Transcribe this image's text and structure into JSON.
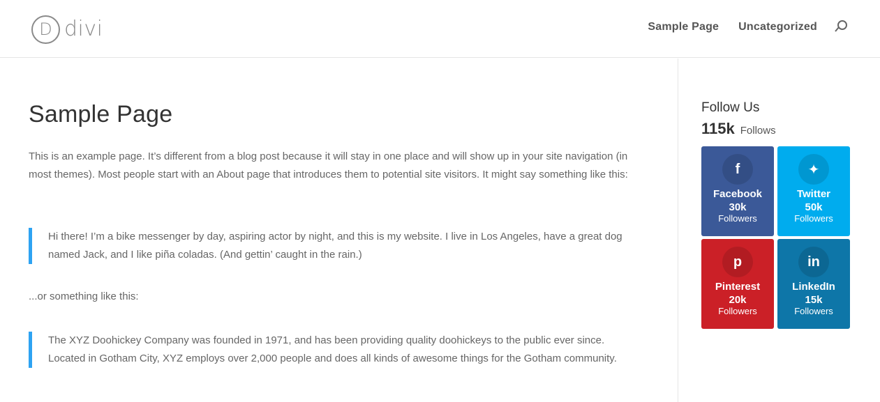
{
  "header": {
    "logo_letter": "D",
    "logo_text": "divi",
    "nav": [
      {
        "label": "Sample Page"
      },
      {
        "label": "Uncategorized"
      }
    ]
  },
  "main": {
    "title": "Sample Page",
    "intro": "This is an example page. It’s different from a blog post because it will stay in one place and will show up in your site navigation (in most themes). Most people start with an About page that introduces them to potential site visitors. It might say something like this:",
    "quote1": "Hi there! I’m a bike messenger by day, aspiring actor by night, and this is my website. I live in Los Angeles, have a great dog named Jack, and I like piña coladas. (And gettin’ caught in the rain.)",
    "between": "...or something like this:",
    "quote2": "The XYZ Doohickey Company was founded in 1971, and has been providing quality doohickeys to the public ever since. Located in Gotham City, XYZ employs over 2,000 people and does all kinds of awesome things for the Gotham community."
  },
  "sidebar": {
    "follow_title": "Follow Us",
    "total": "115k",
    "total_label": "Follows",
    "networks": [
      {
        "name": "Facebook",
        "count": "30k",
        "sub": "Followers",
        "glyph": "f",
        "color": "#3b5998",
        "icon": "facebook-icon"
      },
      {
        "name": "Twitter",
        "count": "50k",
        "sub": "Followers",
        "glyph": "✦",
        "color": "#00acee",
        "icon": "twitter-icon"
      },
      {
        "name": "Pinterest",
        "count": "20k",
        "sub": "Followers",
        "glyph": "p",
        "color": "#cb2027",
        "icon": "pinterest-icon"
      },
      {
        "name": "LinkedIn",
        "count": "15k",
        "sub": "Followers",
        "glyph": "in",
        "color": "#0e76a8",
        "icon": "linkedin-icon"
      }
    ]
  }
}
